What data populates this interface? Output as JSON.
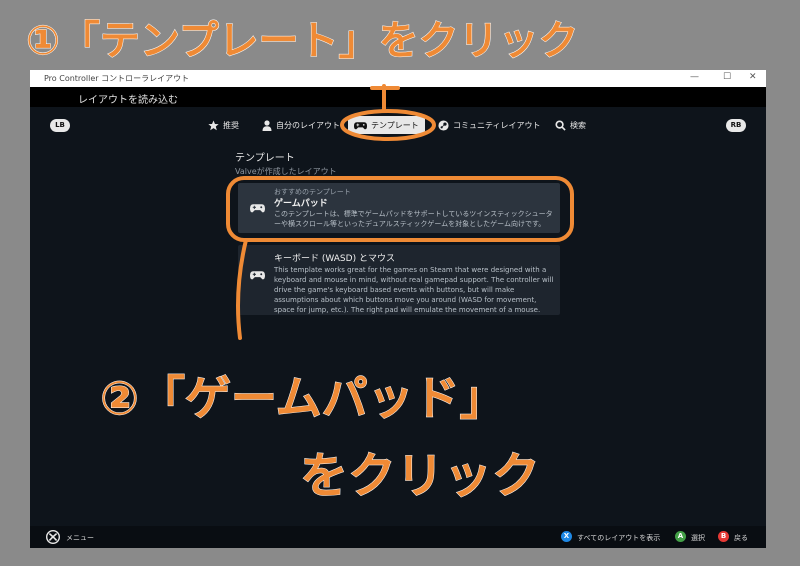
{
  "annotations": {
    "step1": "①「テンプレート」をクリック",
    "step2_line1": "②「ゲームパッド」",
    "step2_line2": "をクリック",
    "color": "#ef8a35"
  },
  "window": {
    "title": "Pro Controller コントローラレイアウト",
    "subheader": "レイアウトを読み込む"
  },
  "nav": {
    "lb": "LB",
    "rb": "RB",
    "tabs": [
      {
        "label": "推奨",
        "icon": "star-icon"
      },
      {
        "label": "自分のレイアウト",
        "icon": "person-icon"
      },
      {
        "label": "テンプレート",
        "icon": "gamepad-icon"
      },
      {
        "label": "コミュニティレイアウト",
        "icon": "steam-icon"
      },
      {
        "label": "検索",
        "icon": "search-icon"
      }
    ]
  },
  "section": {
    "title": "テンプレート",
    "subtitle": "Valveが作成したレイアウト"
  },
  "templates": [
    {
      "tag": "おすすめのテンプレート",
      "name": "ゲームパッド",
      "description": "このテンプレートは、標準でゲームパッドをサポートしているツインスティックシューターや横スクロール等といったデュアルスティックゲームを対象としたゲーム向けです。"
    },
    {
      "name": "キーボード (WASD) とマウス",
      "description": "This template works great for the games on Steam that were designed with a keyboard and mouse in mind, without real gamepad support. The controller will drive the game's keyboard based events with buttons, but will make assumptions about which buttons move you around (WASD for movement, space for jump, etc.). The right pad will emulate the movement of a mouse."
    }
  ],
  "footer": {
    "menu": "メニュー",
    "x_btn": "X",
    "x_label": "すべてのレイアウトを表示",
    "a_btn": "A",
    "a_label": "選択",
    "b_btn": "B",
    "b_label": "戻る",
    "x_color": "#1e88e5",
    "a_color": "#43a047",
    "b_color": "#e53935"
  }
}
